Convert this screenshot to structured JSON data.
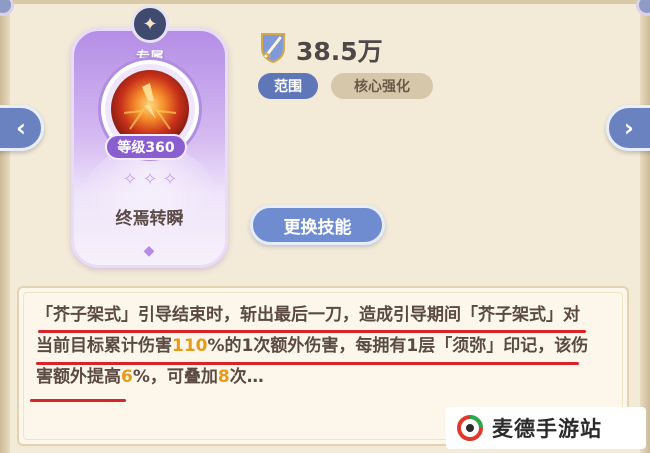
{
  "skill_card": {
    "exclusive_label": "专属",
    "level_label": "等级360",
    "stars": 3,
    "skill_name": "终焉转瞬"
  },
  "power": {
    "value": "38.5万"
  },
  "tags": [
    {
      "label": "范围"
    },
    {
      "label": "核心强化"
    }
  ],
  "change_skill_button": "更换技能",
  "description": {
    "segment_1": "「芥子架式」引导结束时，斩出最后一刀，造成引导期间「芥子架式」对当前目标累计伤害",
    "highlight_1": "110",
    "segment_2": "%的1次额外伤害，每拥有1层「须弥」印记，该伤害额外提高",
    "highlight_2": "6",
    "segment_3": "%，可叠加",
    "highlight_3": "8",
    "segment_4": "次…"
  },
  "watermark": {
    "text": "麦德手游站"
  },
  "colors": {
    "accent_blue": "#6f8cd0",
    "card_purple": "#b48ee6",
    "highlight_orange": "#e69a1c",
    "underline_red": "#d9232a"
  }
}
